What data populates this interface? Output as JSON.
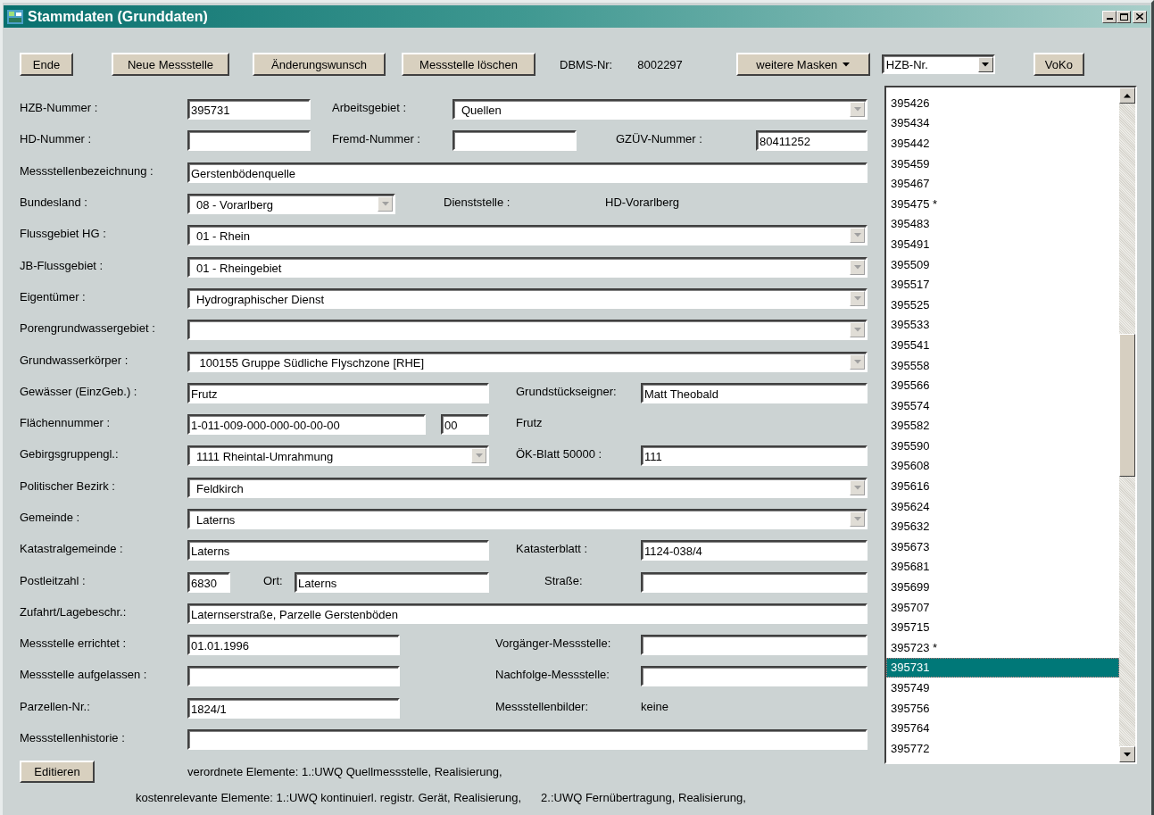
{
  "window": {
    "title": "Stammdaten (Grunddaten)"
  },
  "toolbar": {
    "buttons": [
      "Ende",
      "Neue Messstelle",
      "Änderungswunsch",
      "Messstelle löschen"
    ],
    "dbms_label": "DBMS-Nr:",
    "dbms_number": "8002297",
    "masks_button": "weitere Masken",
    "key_select": "HZB-Nr.",
    "extra_button": "VoKo"
  },
  "form": {
    "lines": [
      {
        "kind": "two-short",
        "parts": [
          {
            "kind": "label",
            "text": "HZB-Nummer :"
          },
          {
            "kind": "field",
            "value": "395731"
          },
          {
            "kind": "label",
            "text": "Arbeitsgebiet :"
          },
          {
            "kind": "combo",
            "value": "Quellen"
          }
        ]
      },
      {
        "kind": "three",
        "parts": [
          {
            "kind": "label",
            "text": "HD-Nummer :"
          },
          {
            "kind": "field"
          },
          {
            "kind": "label",
            "text": "Fremd-Nummer :"
          },
          {
            "kind": "field"
          },
          {
            "kind": "label",
            "text": "GZÜV-Nummer :"
          },
          {
            "kind": "field",
            "value": "80411252"
          }
        ]
      },
      {
        "kind": "full",
        "parts": [
          {
            "kind": "label",
            "text": "Messstellenbezeichnung :"
          },
          {
            "kind": "field",
            "value": "Gerstenbödenquelle"
          }
        ]
      },
      {
        "kind": "with-office",
        "parts": [
          {
            "kind": "label",
            "text": "Bundesland :"
          },
          {
            "kind": "combo",
            "value": "08 - Vorarlberg"
          },
          {
            "kind": "label",
            "text": "Dienststelle :"
          },
          {
            "kind": "text",
            "text": "HD-Vorarlberg"
          }
        ]
      },
      {
        "kind": "full",
        "parts": [
          {
            "kind": "label",
            "text": "Flussgebiet HG :"
          },
          {
            "kind": "combo",
            "value": "01 - Rhein"
          }
        ]
      },
      {
        "kind": "full",
        "parts": [
          {
            "kind": "label",
            "text": "JB-Flussgebiet :"
          },
          {
            "kind": "combo",
            "value": "01 - Rheingebiet"
          }
        ]
      },
      {
        "kind": "full",
        "parts": [
          {
            "kind": "label",
            "text": "Eigentümer :"
          },
          {
            "kind": "combo",
            "value": "Hydrographischer Dienst"
          }
        ]
      },
      {
        "kind": "full",
        "parts": [
          {
            "kind": "label",
            "text": "Porengrundwassergebiet :"
          },
          {
            "kind": "combo"
          }
        ]
      },
      {
        "kind": "full",
        "parts": [
          {
            "kind": "label",
            "text": "Grundwasserkörper :"
          },
          {
            "kind": "combo",
            "value": " 100155 Gruppe Südliche Flyschzone [RHE]"
          }
        ]
      },
      {
        "kind": "pair",
        "parts": [
          {
            "kind": "label",
            "text": "Gewässer (EinzGeb.) :"
          },
          {
            "kind": "field",
            "value": "Frutz"
          },
          {
            "kind": "label",
            "text": "Grundstückseigner:"
          },
          {
            "kind": "field",
            "value": "Matt Theobald"
          }
        ]
      },
      {
        "kind": "split",
        "parts": [
          {
            "kind": "label",
            "text": "Flächennummer :"
          },
          {
            "kind": "field",
            "value": "1-011-009-000-000-00-00-00"
          },
          {
            "kind": "field",
            "value": "00"
          },
          {
            "kind": "text",
            "text": "Frutz"
          }
        ]
      },
      {
        "kind": "pair",
        "parts": [
          {
            "kind": "label",
            "text": "Gebirgsgruppengl.:"
          },
          {
            "kind": "combo",
            "value": "1111 Rheintal-Umrahmung"
          },
          {
            "kind": "label",
            "text": "ÖK-Blatt 50000 :"
          },
          {
            "kind": "field",
            "value": "111"
          }
        ]
      },
      {
        "kind": "full",
        "parts": [
          {
            "kind": "label",
            "text": "Politischer Bezirk :"
          },
          {
            "kind": "combo",
            "value": "Feldkirch"
          }
        ]
      },
      {
        "kind": "full",
        "parts": [
          {
            "kind": "label",
            "text": "Gemeinde :"
          },
          {
            "kind": "combo",
            "value": "Laterns"
          }
        ]
      },
      {
        "kind": "pair",
        "parts": [
          {
            "kind": "label",
            "text": "Katastralgemeinde :"
          },
          {
            "kind": "field",
            "value": "Laterns"
          },
          {
            "kind": "label",
            "text": "Katasterblatt :"
          },
          {
            "kind": "field",
            "value": "1124-038/4"
          }
        ]
      },
      {
        "kind": "address",
        "parts": [
          {
            "kind": "label",
            "text": "Postleitzahl :"
          },
          {
            "kind": "field",
            "value": "6830"
          },
          {
            "kind": "label",
            "text": "Ort:"
          },
          {
            "kind": "field",
            "value": "Laterns"
          },
          {
            "kind": "label",
            "text": "Straße:"
          },
          {
            "kind": "field"
          }
        ]
      },
      {
        "kind": "full",
        "parts": [
          {
            "kind": "label",
            "text": "Zufahrt/Lagebeschr.:"
          },
          {
            "kind": "field",
            "value": "Laternserstraße, Parzelle Gerstenböden"
          }
        ]
      },
      {
        "kind": "pair-left",
        "parts": [
          {
            "kind": "label",
            "text": "Messstelle errichtet :"
          },
          {
            "kind": "field",
            "value": "01.01.1996"
          },
          {
            "kind": "label",
            "text": "Vorgänger-Messstelle:"
          },
          {
            "kind": "field"
          }
        ]
      },
      {
        "kind": "pair-left",
        "parts": [
          {
            "kind": "label",
            "text": "Messstelle aufgelassen :"
          },
          {
            "kind": "field"
          },
          {
            "kind": "label",
            "text": "Nachfolge-Messstelle:"
          },
          {
            "kind": "field"
          }
        ]
      },
      {
        "kind": "pair-left",
        "parts": [
          {
            "kind": "label",
            "text": "Parzellen-Nr.:"
          },
          {
            "kind": "field",
            "value": "1824/1"
          },
          {
            "kind": "label",
            "text": "Messstellenbilder:"
          },
          {
            "kind": "text",
            "text": "keine"
          }
        ]
      },
      {
        "kind": "full",
        "parts": [
          {
            "kind": "label",
            "text": "Messstellenhistorie :"
          },
          {
            "kind": "field"
          }
        ]
      }
    ]
  },
  "footer": {
    "edit_button": "Editieren",
    "ordered_elements": "verordnete Elemente: 1.:UWQ Quellmessstelle, Realisierung,",
    "cost_elements": [
      "kostenrelevante Elemente: 1.:UWQ kontinuierl. registr. Gerät, Realisierung,",
      "2.:UWQ Fernübertragung, Realisierung,"
    ]
  },
  "station_list": {
    "items": [
      {
        "text": "395426",
        "selected": false
      },
      {
        "text": "395434",
        "selected": false
      },
      {
        "text": "395442",
        "selected": false
      },
      {
        "text": "395459",
        "selected": false
      },
      {
        "text": "395467",
        "selected": false
      },
      {
        "text": "395475 *",
        "selected": false
      },
      {
        "text": "395483",
        "selected": false
      },
      {
        "text": "395491",
        "selected": false
      },
      {
        "text": "395509",
        "selected": false
      },
      {
        "text": "395517",
        "selected": false
      },
      {
        "text": "395525",
        "selected": false
      },
      {
        "text": "395533",
        "selected": false
      },
      {
        "text": "395541",
        "selected": false
      },
      {
        "text": "395558",
        "selected": false
      },
      {
        "text": "395566",
        "selected": false
      },
      {
        "text": "395574",
        "selected": false
      },
      {
        "text": "395582",
        "selected": false
      },
      {
        "text": "395590",
        "selected": false
      },
      {
        "text": "395608",
        "selected": false
      },
      {
        "text": "395616",
        "selected": false
      },
      {
        "text": "395624",
        "selected": false
      },
      {
        "text": "395632",
        "selected": false
      },
      {
        "text": "395673",
        "selected": false
      },
      {
        "text": "395681",
        "selected": false
      },
      {
        "text": "395699",
        "selected": false
      },
      {
        "text": "395707",
        "selected": false
      },
      {
        "text": "395715",
        "selected": false
      },
      {
        "text": "395723 *",
        "selected": false
      },
      {
        "text": "395731",
        "selected": true
      },
      {
        "text": "395749",
        "selected": false
      },
      {
        "text": "395756",
        "selected": false
      },
      {
        "text": "395764",
        "selected": false
      },
      {
        "text": "395772",
        "selected": false
      }
    ]
  }
}
